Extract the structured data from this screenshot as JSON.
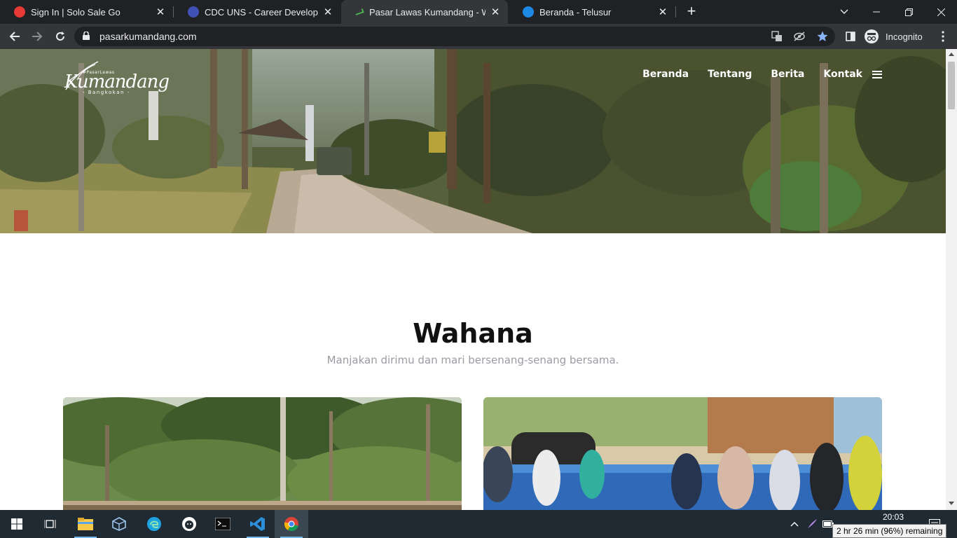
{
  "browser": {
    "tabs": [
      {
        "title": "Sign In | Solo Sale Go",
        "favicon_color": "#e53935",
        "active": false
      },
      {
        "title": "CDC UNS - Career Development",
        "favicon_color": "#3f51b5",
        "active": false
      },
      {
        "title": "Pasar Lawas Kumandang - Wisata",
        "favicon_color": "#4caf50",
        "active": true
      },
      {
        "title": "Beranda - Telusur",
        "favicon_color": "#1e88e5",
        "active": false
      }
    ],
    "close_glyph": "✕",
    "new_tab_glyph": "+",
    "url": "pasarkumandang.com",
    "profile_label": "Incognito"
  },
  "site": {
    "logo": {
      "small": "#PasarLawas",
      "main": "Kumandang",
      "sub": "- Bangkokan -"
    },
    "nav": [
      {
        "label": "Beranda"
      },
      {
        "label": "Tentang"
      },
      {
        "label": "Berita"
      },
      {
        "label": "Kontak"
      }
    ],
    "section": {
      "title": "Wahana",
      "subtitle": "Manjakan dirimu dan mari bersenang-senang bersama."
    }
  },
  "taskbar": {
    "time": "20:03",
    "battery_tooltip": "2 hr 26 min (96%) remaining"
  },
  "colors": {
    "chrome_dark": "#202124",
    "chrome_toolbar": "#35363a",
    "bookmark_star": "#8ab4f8",
    "taskbar": "#1f2a33",
    "heading": "#111111",
    "subtitle": "#9a9ca3"
  }
}
